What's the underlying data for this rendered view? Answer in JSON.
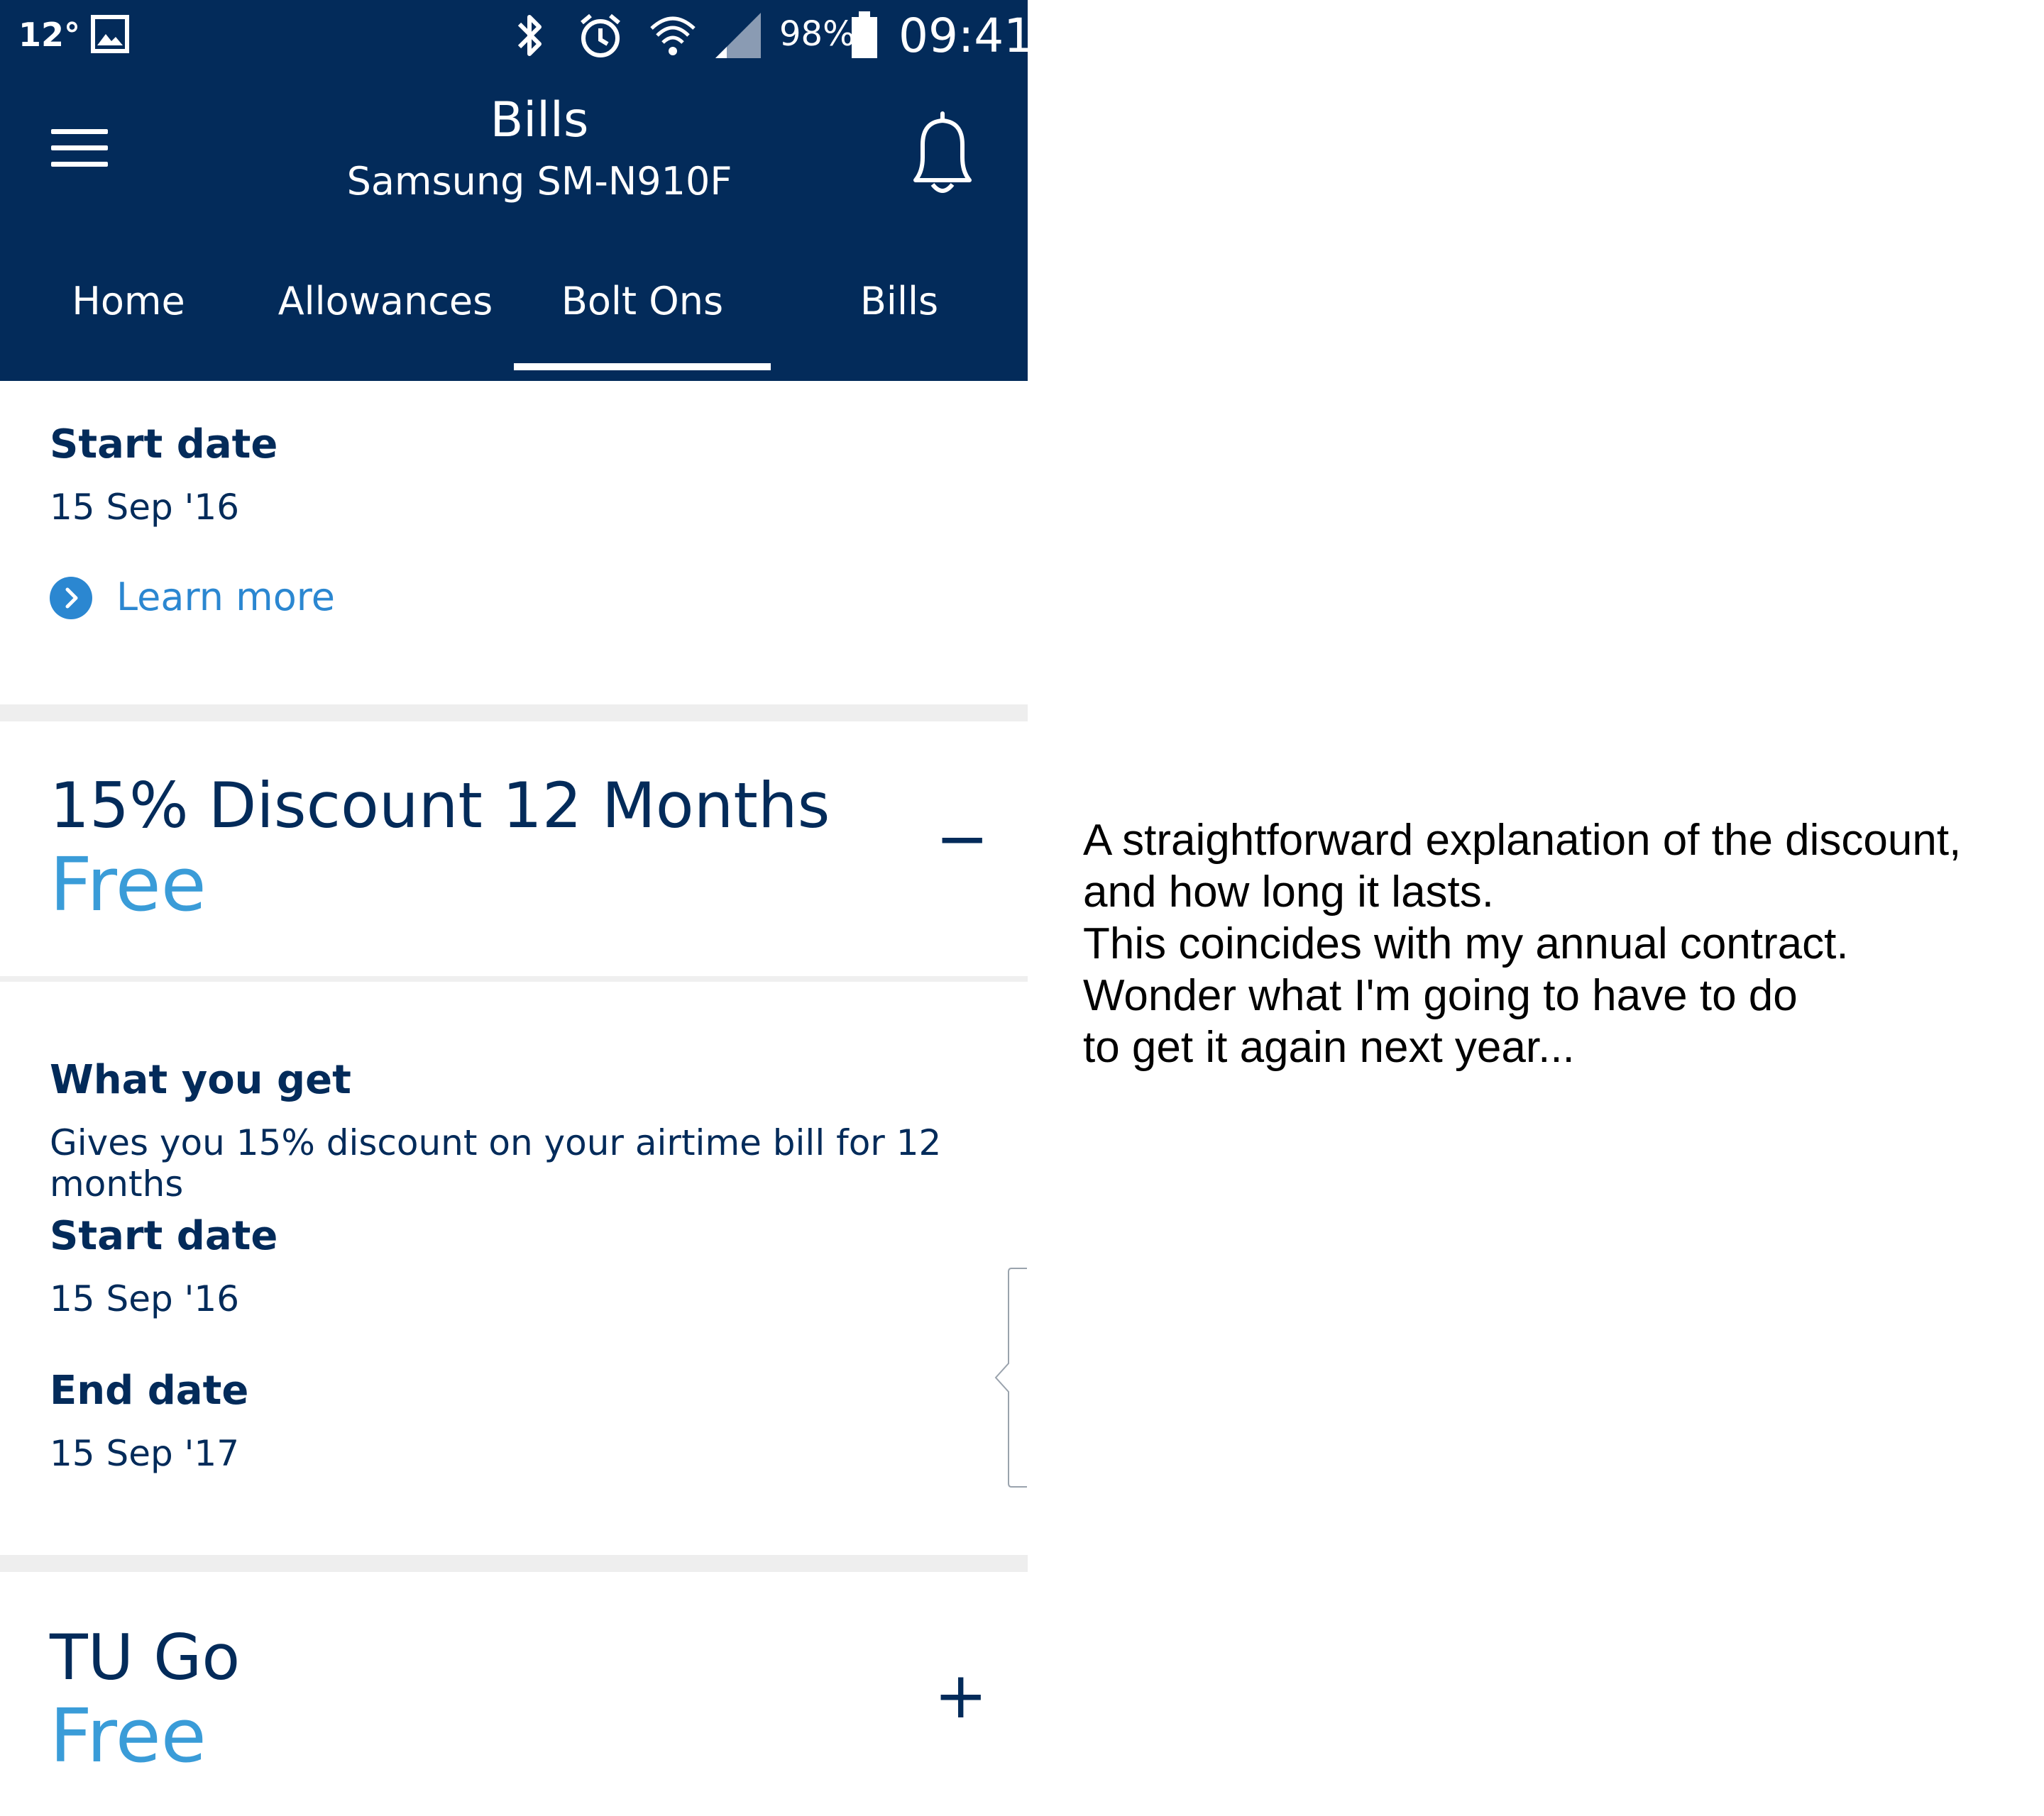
{
  "status_bar": {
    "temperature": "12°",
    "battery_percent": "98%",
    "time": "09:41",
    "icons": [
      "gallery-icon",
      "bluetooth-icon",
      "alarm-icon",
      "wifi-icon",
      "signal-icon",
      "battery-icon"
    ]
  },
  "header": {
    "title": "Bills",
    "subtitle": "Samsung SM-N910F"
  },
  "tabs": [
    {
      "label": "Home"
    },
    {
      "label": "Allowances"
    },
    {
      "label": "Bolt Ons",
      "selected": true
    },
    {
      "label": "Bills"
    }
  ],
  "section_top": {
    "start_label": "Start date",
    "start_value": "15 Sep '16",
    "learn_more": "Learn more"
  },
  "bolt_on_discount": {
    "title": "15% Discount 12 Months",
    "price": "Free",
    "toggle": "−",
    "what_label": "What you get",
    "what_value": "Gives you 15% discount on your airtime bill for 12 months",
    "start_label": "Start date",
    "start_value": "15 Sep '16",
    "end_label": "End date",
    "end_value": "15 Sep '17"
  },
  "bolt_on_tugo": {
    "title": "TU Go",
    "price": "Free",
    "toggle": "+"
  },
  "annotation": {
    "lines": [
      "A straightforward explanation of the discount,",
      "and how long it lasts.",
      "This coincides with my annual contract.",
      "Wonder what I'm going to have to do",
      "to get it again next year..."
    ]
  },
  "colors": {
    "header_bg": "#032b5a",
    "primary_text": "#032b5a",
    "accent_blue": "#3a9cd8",
    "link_blue": "#2b87d1"
  }
}
